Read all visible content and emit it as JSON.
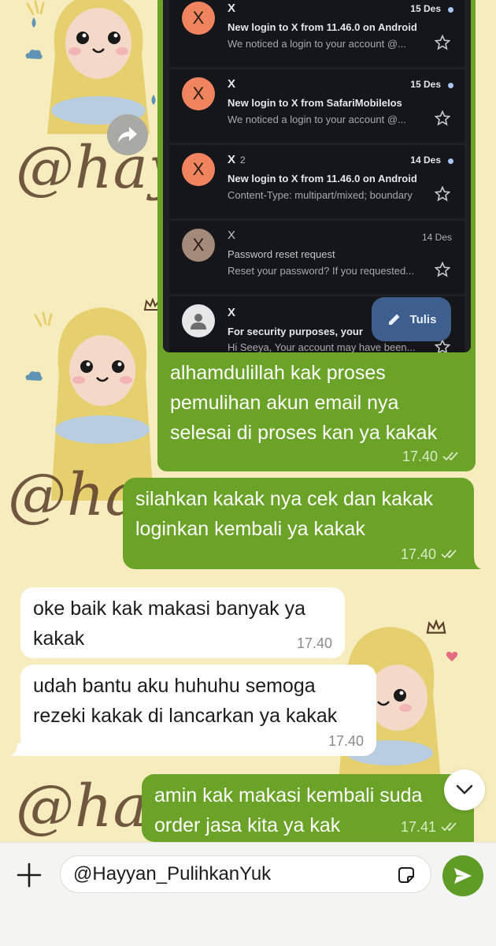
{
  "watermark": "@hayyan",
  "email_screenshot": {
    "compose_label": "Tulis",
    "emails": [
      {
        "avatar": "X",
        "sender": "X",
        "count": "",
        "date": "15 Des",
        "unread": true,
        "subject": "New login to X from 11.46.0 on Android",
        "snippet": "We noticed a login to your account @..."
      },
      {
        "avatar": "X",
        "sender": "X",
        "count": "",
        "date": "15 Des",
        "unread": true,
        "subject": "New login to X from SafariMobileIos",
        "snippet": "We noticed a login to your account @..."
      },
      {
        "avatar": "X",
        "sender": "X",
        "count": "2",
        "date": "14 Des",
        "unread": true,
        "subject": "New login to X from 11.46.0 on Android",
        "snippet": "Content-Type: multipart/mixed; boundary"
      },
      {
        "avatar": "X",
        "sender": "X",
        "count": "",
        "date": "14 Des",
        "unread": false,
        "subject": "Password reset request",
        "snippet": "Reset your password? If you requested..."
      },
      {
        "avatar": "",
        "sender": "X",
        "count": "",
        "date": "",
        "unread": true,
        "subject": "For security purposes, your",
        "snippet": "Hi Seeya, Your account may have been..."
      }
    ]
  },
  "messages": [
    {
      "direction": "out",
      "text": "alhamdulillah kak proses pemulihan akun email nya selesai di proses kan ya kakak",
      "time": "17.40",
      "read": true
    },
    {
      "direction": "out",
      "text": "silahkan kakak nya cek dan kakak loginkan kembali ya kakak",
      "time": "17.40",
      "read": true
    },
    {
      "direction": "in",
      "text": "oke baik kak makasi banyak ya kakak",
      "time": "17.40"
    },
    {
      "direction": "in",
      "text": "udah bantu aku huhuhu semoga rezeki kakak di lancarkan ya kakak",
      "time": "17.40"
    },
    {
      "direction": "out",
      "text": "amin kak makasi kembali suda order jasa kita ya kak",
      "time": "17.41",
      "read": true
    }
  ],
  "composer": {
    "value": "@Hayyan_PulihkanYuk"
  },
  "colors": {
    "background": "#f6ecbd",
    "outgoing_bubble": "#6aa327",
    "incoming_bubble": "#ffffff",
    "send_button": "#5f9c26"
  },
  "icons": {
    "forward": "forward-arrow-icon",
    "star": "star-outline-icon",
    "compose": "pencil-icon",
    "read_receipt": "double-check-icon",
    "scroll_down": "chevron-down-icon",
    "attach": "plus-icon",
    "sticker": "sticker-icon",
    "send": "send-icon"
  }
}
